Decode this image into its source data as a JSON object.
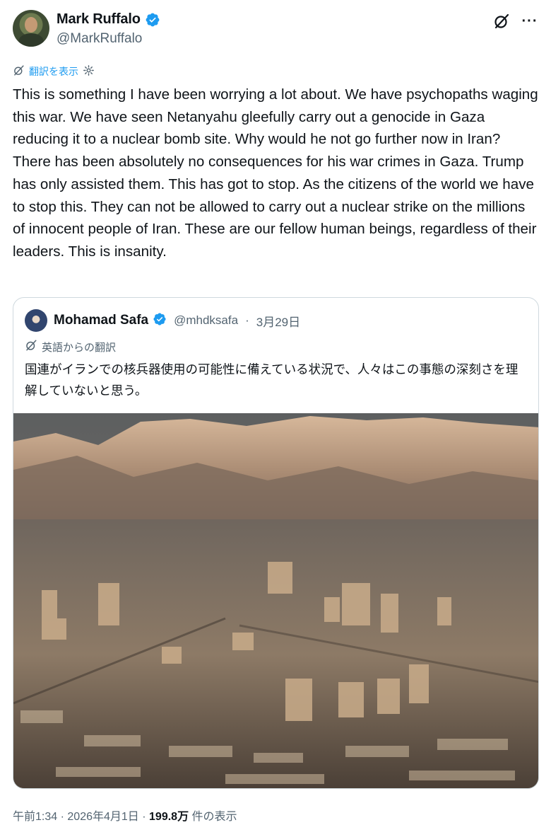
{
  "author": {
    "name": "Mark Ruffalo",
    "handle": "@MarkRuffalo",
    "avatar_icon": "profile-photo",
    "verified": true,
    "verified_color": "#1d9bf0"
  },
  "header_icons": [
    "grok-icon",
    "more-icon"
  ],
  "more_label": "···",
  "translate": {
    "label": "翻訳を表示",
    "icon": "grok-icon",
    "settings_icon": "gear-icon"
  },
  "tweet_text": "This is something I have been worrying a lot about. We have psychopaths waging this war. We have seen Netanyahu gleefully carry out a genocide in Gaza reducing it to a nuclear bomb site. Why would he not go further now in Iran? There has been absolutely no consequences for his war crimes in Gaza. Trump has only assisted them. This has got to stop. As the citizens of the world we have to stop this. They can not be allowed to carry out a nuclear strike on the millions of innocent people of Iran. These are our fellow human beings, regardless of their leaders. This is insanity.",
  "quote": {
    "name": "Mohamad Safa",
    "handle": "@mhdksafa",
    "separator": "·",
    "date": "3月29日",
    "verified": true,
    "translated_label": "英語からの翻訳",
    "text": "国連がイランでの核兵器使用の可能性に備えている状況で、人々はこの事態の深刻さを理解していないと思う。",
    "photo": "aerial-city-with-mountains"
  },
  "meta": {
    "time": "午前1:34",
    "sep1": "·",
    "date": "2026年4月1日",
    "sep2": "·",
    "views": "199.8万",
    "views_suffix": "件の表示"
  },
  "colors": {
    "accent": "#1d9bf0",
    "secondary_text": "#536471",
    "border": "#cfd9de"
  }
}
